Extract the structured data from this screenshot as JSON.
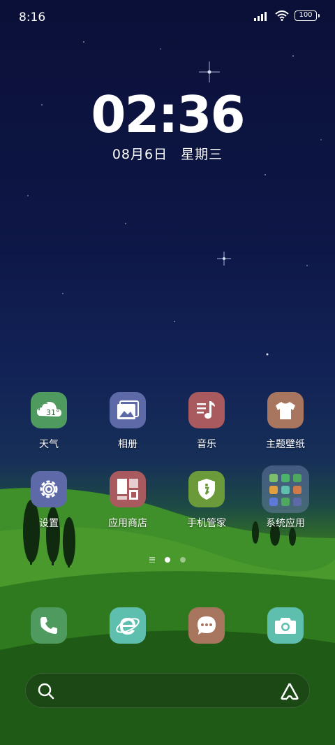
{
  "status_bar": {
    "time": "8:16",
    "battery": "100"
  },
  "lock_clock": {
    "time": "02:36",
    "date": "08月6日",
    "weekday": "星期三"
  },
  "apps": [
    {
      "label": "天气",
      "icon": "weather-icon",
      "color": "#4f9a5e",
      "badge": "31°"
    },
    {
      "label": "相册",
      "icon": "gallery-icon",
      "color": "#5e6aa8"
    },
    {
      "label": "音乐",
      "icon": "music-icon",
      "color": "#a85a5e"
    },
    {
      "label": "主题壁纸",
      "icon": "theme-icon",
      "color": "#a8765e"
    },
    {
      "label": "设置",
      "icon": "settings-icon",
      "color": "#5e6aa8"
    },
    {
      "label": "应用商店",
      "icon": "app-store-icon",
      "color": "#a85a5e"
    },
    {
      "label": "手机管家",
      "icon": "security-icon",
      "color": "#6a9a3a"
    },
    {
      "label": "系统应用",
      "icon": "folder-icon",
      "color": "#7a8cb4"
    }
  ],
  "dock": [
    {
      "icon": "phone-icon",
      "color": "#4f9a5e"
    },
    {
      "icon": "browser-icon",
      "color": "#5ebfae"
    },
    {
      "icon": "messages-icon",
      "color": "#a8765e"
    },
    {
      "icon": "camera-icon",
      "color": "#5ebfae"
    }
  ],
  "colors": {
    "sky_top": "#0b1038",
    "grass": "#3d8a27"
  }
}
